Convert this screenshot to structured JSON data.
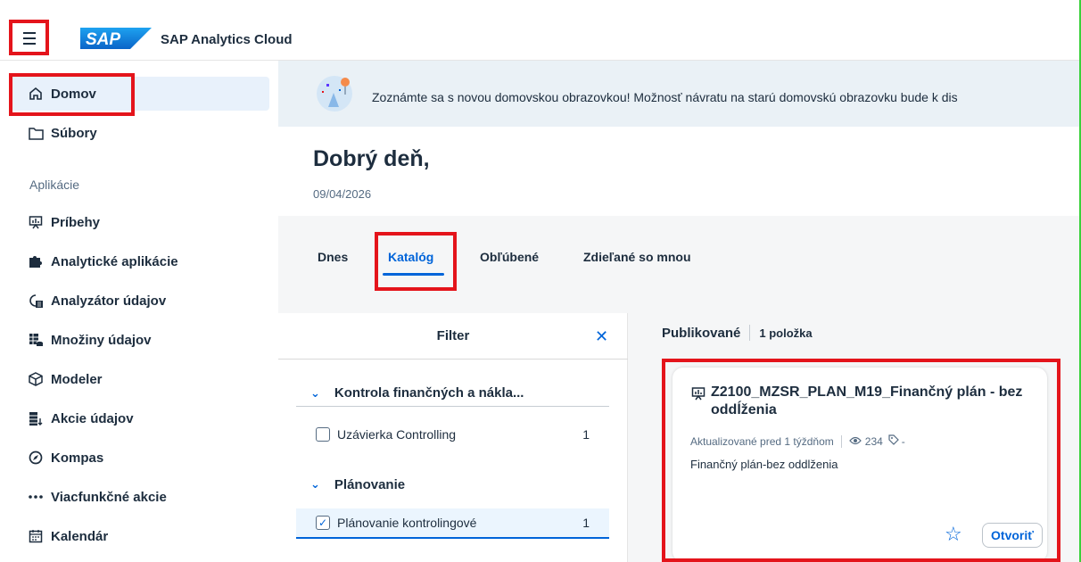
{
  "shell": {
    "app_title": "SAP Analytics Cloud",
    "logo_text": "SAP"
  },
  "sidenav": {
    "top_items": [
      {
        "label": "Domov",
        "icon": "home-icon"
      },
      {
        "label": "Súbory",
        "icon": "folder-icon"
      }
    ],
    "group_label": "Aplikácie",
    "apps": [
      {
        "label": "Príbehy",
        "icon": "story-icon"
      },
      {
        "label": "Analytické aplikácie",
        "icon": "puzzle-icon"
      },
      {
        "label": "Analyzátor údajov",
        "icon": "data-analyzer-icon"
      },
      {
        "label": "Množiny údajov",
        "icon": "dataset-icon"
      },
      {
        "label": "Modeler",
        "icon": "cube-icon"
      },
      {
        "label": "Akcie údajov",
        "icon": "data-action-icon"
      },
      {
        "label": "Kompas",
        "icon": "compass-icon"
      },
      {
        "label": "Viacfunkčné akcie",
        "icon": "more-icon"
      },
      {
        "label": "Kalendár",
        "icon": "calendar-icon"
      }
    ]
  },
  "banner": {
    "text": "Zoznámte sa s novou domovskou obrazovkou! Možnosť návratu na starú domovskú obrazovku bude k dis"
  },
  "greeting": {
    "title": "Dobrý deň,",
    "date": "09/04/2026"
  },
  "tabs": [
    {
      "label": "Dnes"
    },
    {
      "label": "Katalóg",
      "active": true
    },
    {
      "label": "Obľúbené"
    },
    {
      "label": "Zdieľané so mnou"
    }
  ],
  "filter": {
    "title": "Filter",
    "groups": [
      {
        "label": "Kontrola finančných a nákla...",
        "options": [
          {
            "label": "Uzávierka Controlling",
            "count": "1",
            "checked": false
          }
        ]
      },
      {
        "label": "Plánovanie",
        "options": [
          {
            "label": "Plánovanie kontrolingové",
            "count": "1",
            "checked": true
          }
        ]
      }
    ]
  },
  "results": {
    "heading": "Publikované",
    "count": "1 položka",
    "card": {
      "title": "Z2100_MZSR_PLAN_M19_Finančný plán - bez oddĺženia",
      "updated": "Aktualizované pred 1 týždňom",
      "views": "234",
      "tags": "-",
      "description": "Finančný plán-bez oddlženia",
      "open_label": "Otvoriť"
    }
  },
  "colors": {
    "accent": "#0064d9",
    "highlight": "#e4141b",
    "text": "#1d2d3e"
  }
}
